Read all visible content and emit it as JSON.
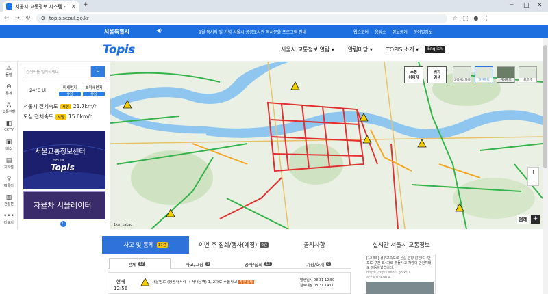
{
  "browser": {
    "tab_title": "서울시 교통정보 시스템 - TOP",
    "url": "topis.seoul.go.kr"
  },
  "topbar": {
    "org": "서울특별시",
    "notice": "9월 독서의 달 기념 서울시 공공도서관 독서문화 프로그램 안내",
    "links": [
      "웹스토어",
      "응답소",
      "정보공개",
      "분야별정보"
    ]
  },
  "header": {
    "logo": "Topis",
    "nav": [
      "서울시 교통정보 열람 ▾",
      "알림마당 ▾",
      "TOPIS 소개 ▾"
    ],
    "english": "English"
  },
  "sidebar": [
    "돌발",
    "통제",
    "소통현황",
    "CCTV",
    "버스",
    "지하철",
    "따릉이",
    "건설편",
    "더보기"
  ],
  "panel": {
    "search_placeholder": "검색어를 입력하세요",
    "temp": "24°C 비",
    "pm10_label": "미세먼지",
    "pm10_value": "좋음",
    "pm25_label": "초미세먼지",
    "pm25_value": "좋음",
    "city_speed_label": "서울시 전체속도",
    "city_speed_badge": "서행",
    "city_speed": "21.7km/h",
    "downtown_label": "도심 전체속도",
    "downtown_badge": "서행",
    "downtown_speed": "15.6km/h",
    "promo1_title": "서울교통정보센터",
    "promo1_logo": "Topis",
    "promo1_sub": "SEOUL",
    "promo2_title": "자율차 시뮬레이터"
  },
  "map": {
    "btn_traffic": "소통\n이미지",
    "btn_location": "위치\n검색",
    "types": [
      "색각이상자용",
      "일반지도",
      "위성지도",
      "로드뷰"
    ],
    "legend": "범례",
    "scale": "1km kakao",
    "zoom_plus": "+",
    "zoom_minus": "−"
  },
  "bottom_tabs": [
    {
      "label": "사고 및 통제",
      "count": "17건"
    },
    {
      "label": "이번 주 집회/행사(예정)",
      "count": "0건"
    },
    {
      "label": "공지사항",
      "count": ""
    },
    {
      "label": "실시간 서울시 교통정보",
      "count": ""
    }
  ],
  "sub_tabs": [
    {
      "label": "전체",
      "count": "17"
    },
    {
      "label": "사고/고장",
      "count": "5"
    },
    {
      "label": "공사/집회",
      "count": "12"
    },
    {
      "label": "기상/화재",
      "count": "0"
    }
  ],
  "incident": {
    "now": "현재",
    "time": "12:56",
    "text": "새문안로 (정동사거리 → 서대문역) 1, 2차로 추돌사고",
    "tag": "부분통제",
    "start": "발생일시 08.31 12:50",
    "end": "완료예정 08.31 14:00"
  },
  "live_info": {
    "text": "[12:55] 경부고속도로 신갈 방향 잠원IC→반포IC 구간 3,4차로 추돌사고 차량이 안전지대로 이동하였습니다.",
    "link": "https://topis.seoul.go.kr/?acc=1097404"
  }
}
